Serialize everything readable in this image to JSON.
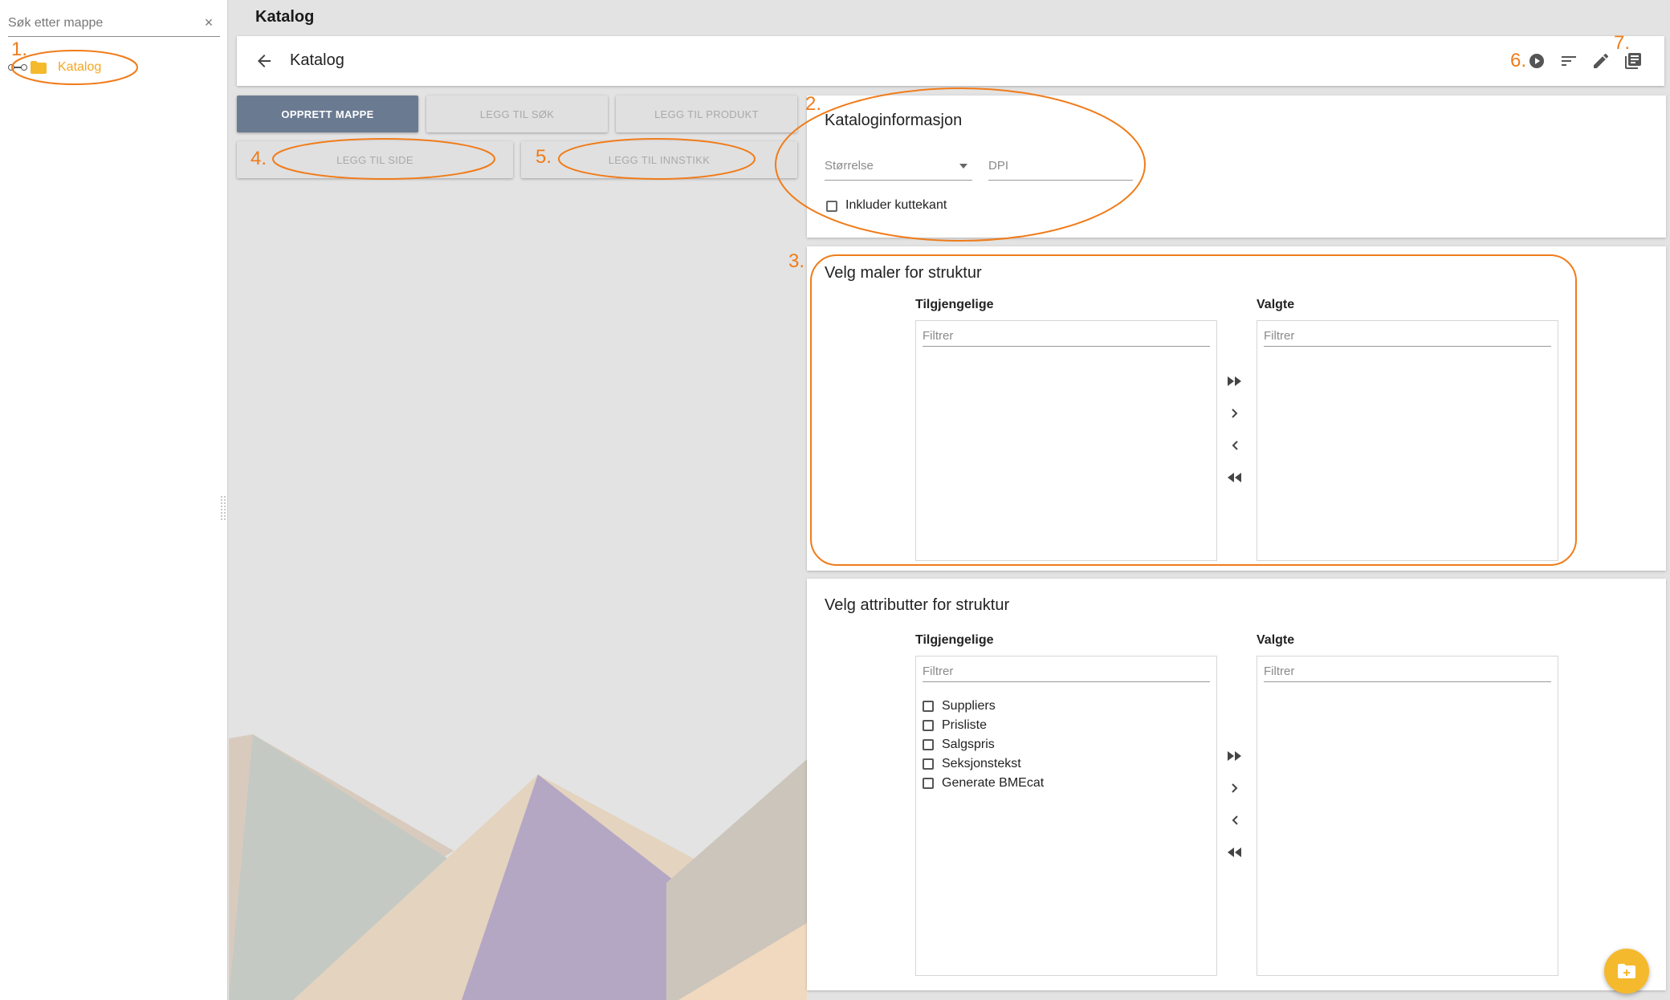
{
  "sidebar": {
    "search_placeholder": "Søk etter mappe",
    "clear_icon": "×",
    "tree": [
      {
        "label": "Katalog"
      }
    ]
  },
  "header": {
    "title": "Katalog"
  },
  "toolbar": {
    "title": "Katalog",
    "icons": [
      "back-arrow-icon",
      "play-circle-icon",
      "sort-icon",
      "edit-icon",
      "library-books-icon"
    ]
  },
  "actions": {
    "create_folder": "OPPRETT MAPPE",
    "add_search": "LEGG TIL SØK",
    "add_product": "LEGG TIL PRODUKT",
    "add_page": "LEGG TIL SIDE",
    "add_insert": "LEGG TIL INNSTIKK"
  },
  "catalog_info": {
    "title": "Kataloginformasjon",
    "size_placeholder": "Størrelse",
    "dpi_placeholder": "DPI",
    "include_bleed_label": "Inkluder kuttekant"
  },
  "templates": {
    "title": "Velg maler for struktur",
    "available_label": "Tilgjengelige",
    "selected_label": "Valgte",
    "filter_placeholder": "Filtrer",
    "available_items": [],
    "selected_items": []
  },
  "attributes": {
    "title": "Velg attributter for struktur",
    "available_label": "Tilgjengelige",
    "selected_label": "Valgte",
    "filter_placeholder": "Filtrer",
    "available_items": [
      "Suppliers",
      "Prisliste",
      "Salgspris",
      "Seksjonstekst",
      "Generate BMEcat"
    ],
    "selected_items": []
  },
  "transfer_controls": [
    "move-all-right",
    "move-right",
    "move-left",
    "move-all-left"
  ],
  "annotations": [
    "1.",
    "2.",
    "3.",
    "4.",
    "5.",
    "6.",
    "7."
  ],
  "colors": {
    "accent_orange": "#f07c1a",
    "folder_yellow": "#f5b92e",
    "primary_button": "#6a7a91",
    "tree_label": "#f5a623"
  }
}
